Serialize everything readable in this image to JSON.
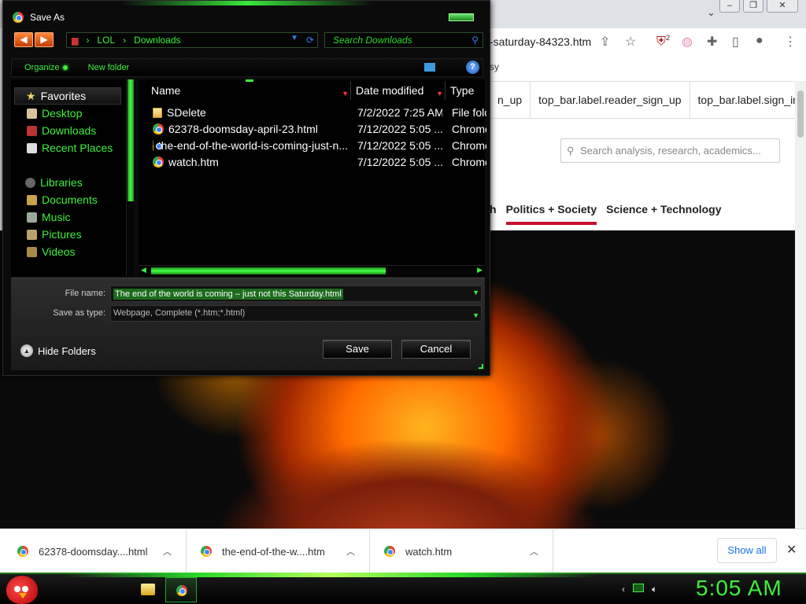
{
  "browser": {
    "url_fragment": "-saturday-84323.htm",
    "bookmark_fragment": "sy",
    "extension_badge": "2",
    "top_nav": [
      "n_up",
      "top_bar.label.reader_sign_up",
      "top_bar.label.sign_in"
    ],
    "search_placeholder": "Search analysis, research, academics...",
    "categories": [
      "h",
      "Politics + Society",
      "Science + Technology"
    ],
    "active_category_color": "#c8102e"
  },
  "dialog": {
    "title": "Save As",
    "breadcrumb": [
      "LOL",
      "Downloads"
    ],
    "search_placeholder": "Search Downloads",
    "toolbar": {
      "organize": "Organize",
      "new_folder": "New folder",
      "help": "?"
    },
    "nav": {
      "favorites_label": "Favorites",
      "favorites": [
        "Desktop",
        "Downloads",
        "Recent Places"
      ],
      "libraries_label": "Libraries",
      "libraries": [
        "Documents",
        "Music",
        "Pictures",
        "Videos"
      ]
    },
    "columns": {
      "name": "Name",
      "date": "Date modified",
      "type": "Type"
    },
    "files": [
      {
        "name": "SDelete",
        "date": "7/2/2022 7:25 AM",
        "type": "File folc",
        "icon": "folder-icon"
      },
      {
        "name": "62378-doomsday-april-23.html",
        "date": "7/12/2022 5:05 ...",
        "type": "Chrome",
        "icon": "chrome-icon"
      },
      {
        "name": "the-end-of-the-world-is-coming-just-n...",
        "date": "7/12/2022 5:05 ...",
        "type": "Chrome",
        "icon": "chrome-icon"
      },
      {
        "name": "watch.htm",
        "date": "7/12/2022 5:05 ...",
        "type": "Chrome",
        "icon": "chrome-icon"
      }
    ],
    "file_name_label": "File name:",
    "file_name_value": "The end of the world is coming – just not this Saturday.html",
    "save_type_label": "Save as type:",
    "save_type_value": "Webpage, Complete (*.htm;*.html)",
    "hide_folders": "Hide Folders",
    "save_button": "Save",
    "cancel_button": "Cancel",
    "accent_color": "#3cf03c"
  },
  "downloads": {
    "items": [
      "62378-doomsday....html",
      "the-end-of-the-w....htm",
      "watch.htm"
    ],
    "show_all": "Show all",
    "close": "✕"
  },
  "taskbar": {
    "clock": "5:05 AM"
  }
}
